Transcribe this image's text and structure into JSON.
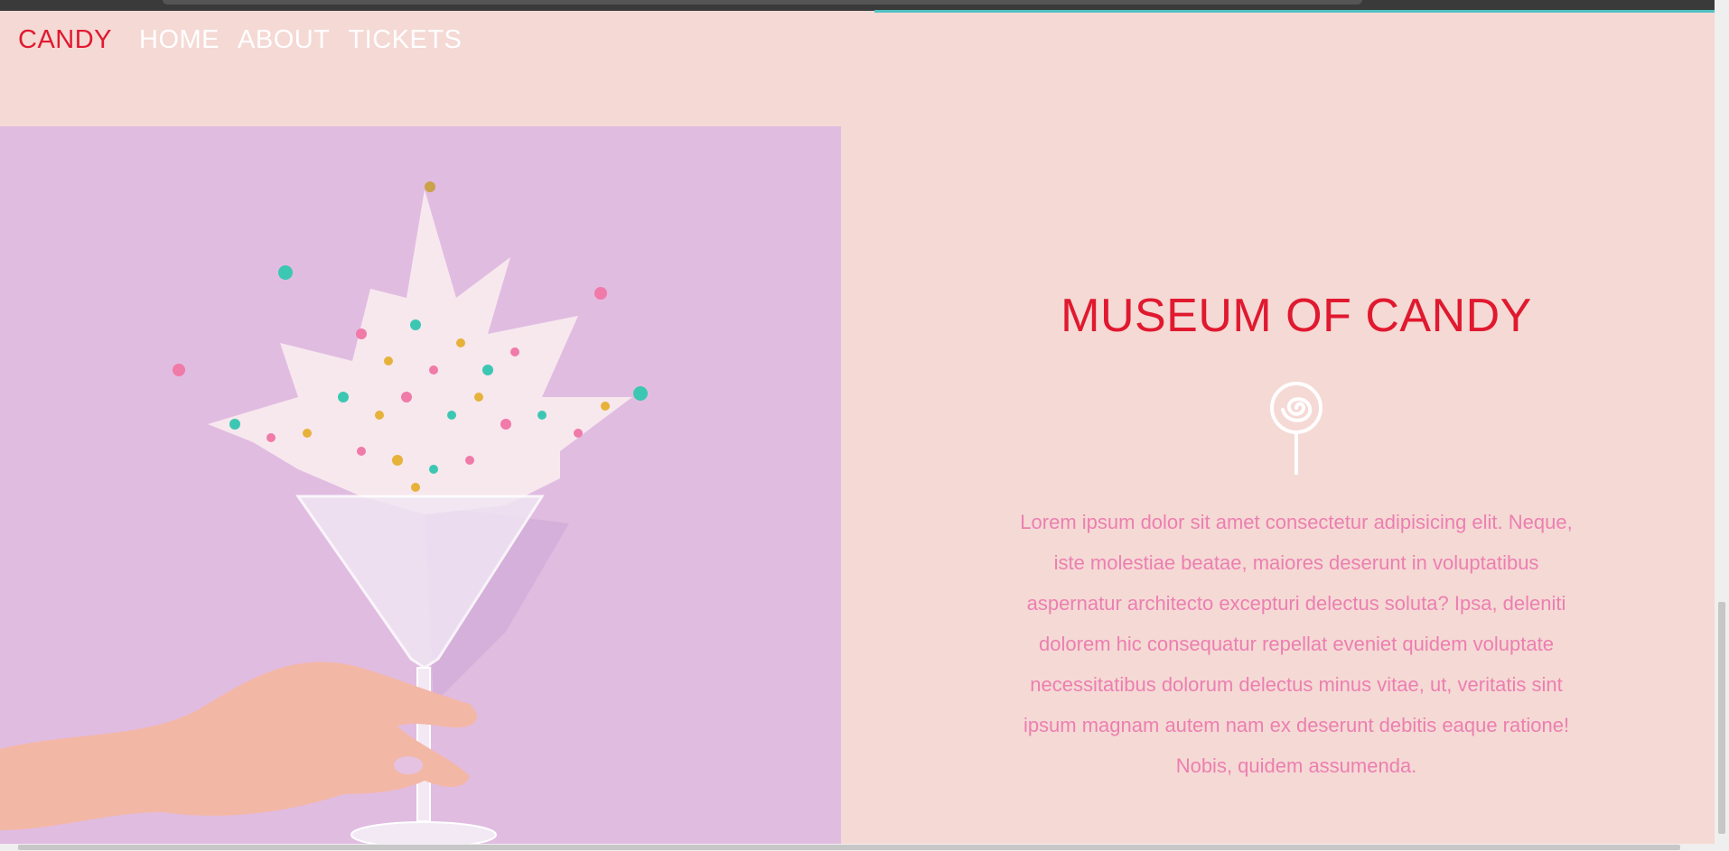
{
  "nav": {
    "brand": "CANDY",
    "links": [
      "HOME",
      "ABOUT",
      "TICKETS"
    ]
  },
  "hero": {
    "image_alt": "sprinkles bursting from a martini glass held by a hand"
  },
  "main": {
    "title": "MUSEUM OF CANDY",
    "icon": "lollipop-icon",
    "description": "Lorem ipsum dolor sit amet consectetur adipisicing elit. Neque, iste molestiae beatae, maiores deserunt in voluptatibus aspernatur architecto excepturi delectus soluta? Ipsa, deleniti dolorem hic consequatur repellat eveniet quidem voluptate necessitatibus dolorum delectus minus vitae, ut, veritatis sint ipsum magnam autem nam ex deserunt debitis eaque ratione! Nobis, quidem assumenda."
  },
  "colors": {
    "background": "#f5d9d5",
    "brand_red": "#e0192f",
    "text_pink": "#ec7fb0",
    "image_bg": "#e1bce1",
    "accent_teal": "#4fc1c2"
  }
}
